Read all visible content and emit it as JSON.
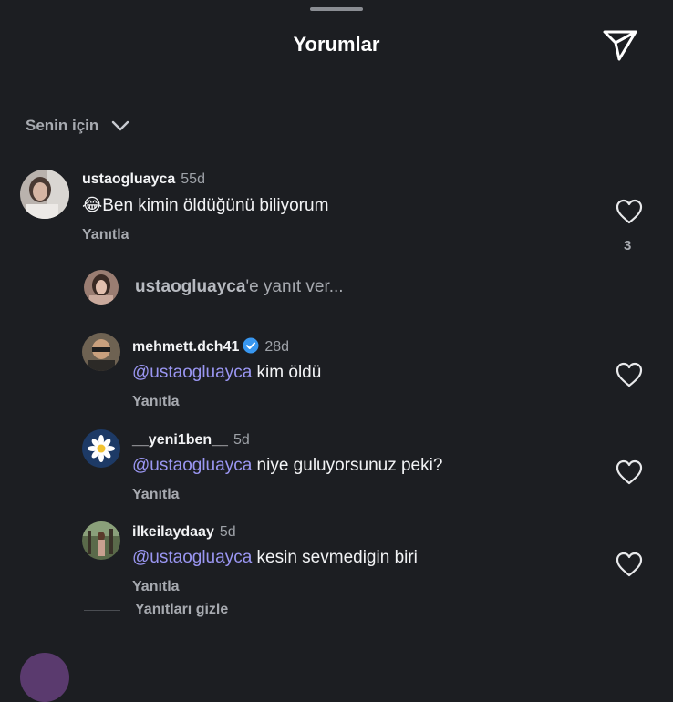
{
  "header": {
    "title": "Yorumlar"
  },
  "filter": {
    "label": "Senin için"
  },
  "comment": {
    "username": "ustaogluayca",
    "time": "55d",
    "emoji": "😂",
    "text": "Ben kimin öldüğünü biliyorum",
    "reply_label": "Yanıtla",
    "likes": "3"
  },
  "reply_input": {
    "username": "ustaogluayca",
    "suffix": "'e yanıt ver..."
  },
  "replies": [
    {
      "username": "mehmett.dch41",
      "verified": true,
      "time": "28d",
      "mention": "@ustaogluayca",
      "text": "kim öldü",
      "reply_label": "Yanıtla"
    },
    {
      "username": "__yeni1ben__",
      "verified": false,
      "time": "5d",
      "mention": "@ustaogluayca",
      "text": "niye guluyorsunuz peki?",
      "reply_label": "Yanıtla"
    },
    {
      "username": "ilkeilaydaay",
      "verified": false,
      "time": "5d",
      "mention": "@ustaogluayca",
      "text": "kesin sevmedigin biri",
      "reply_label": "Yanıtla"
    }
  ],
  "hide_replies": {
    "label": "Yanıtları gizle"
  },
  "colors": {
    "background": "#1c1e22",
    "mention": "#9a96f2",
    "verified": "#3897f0"
  }
}
